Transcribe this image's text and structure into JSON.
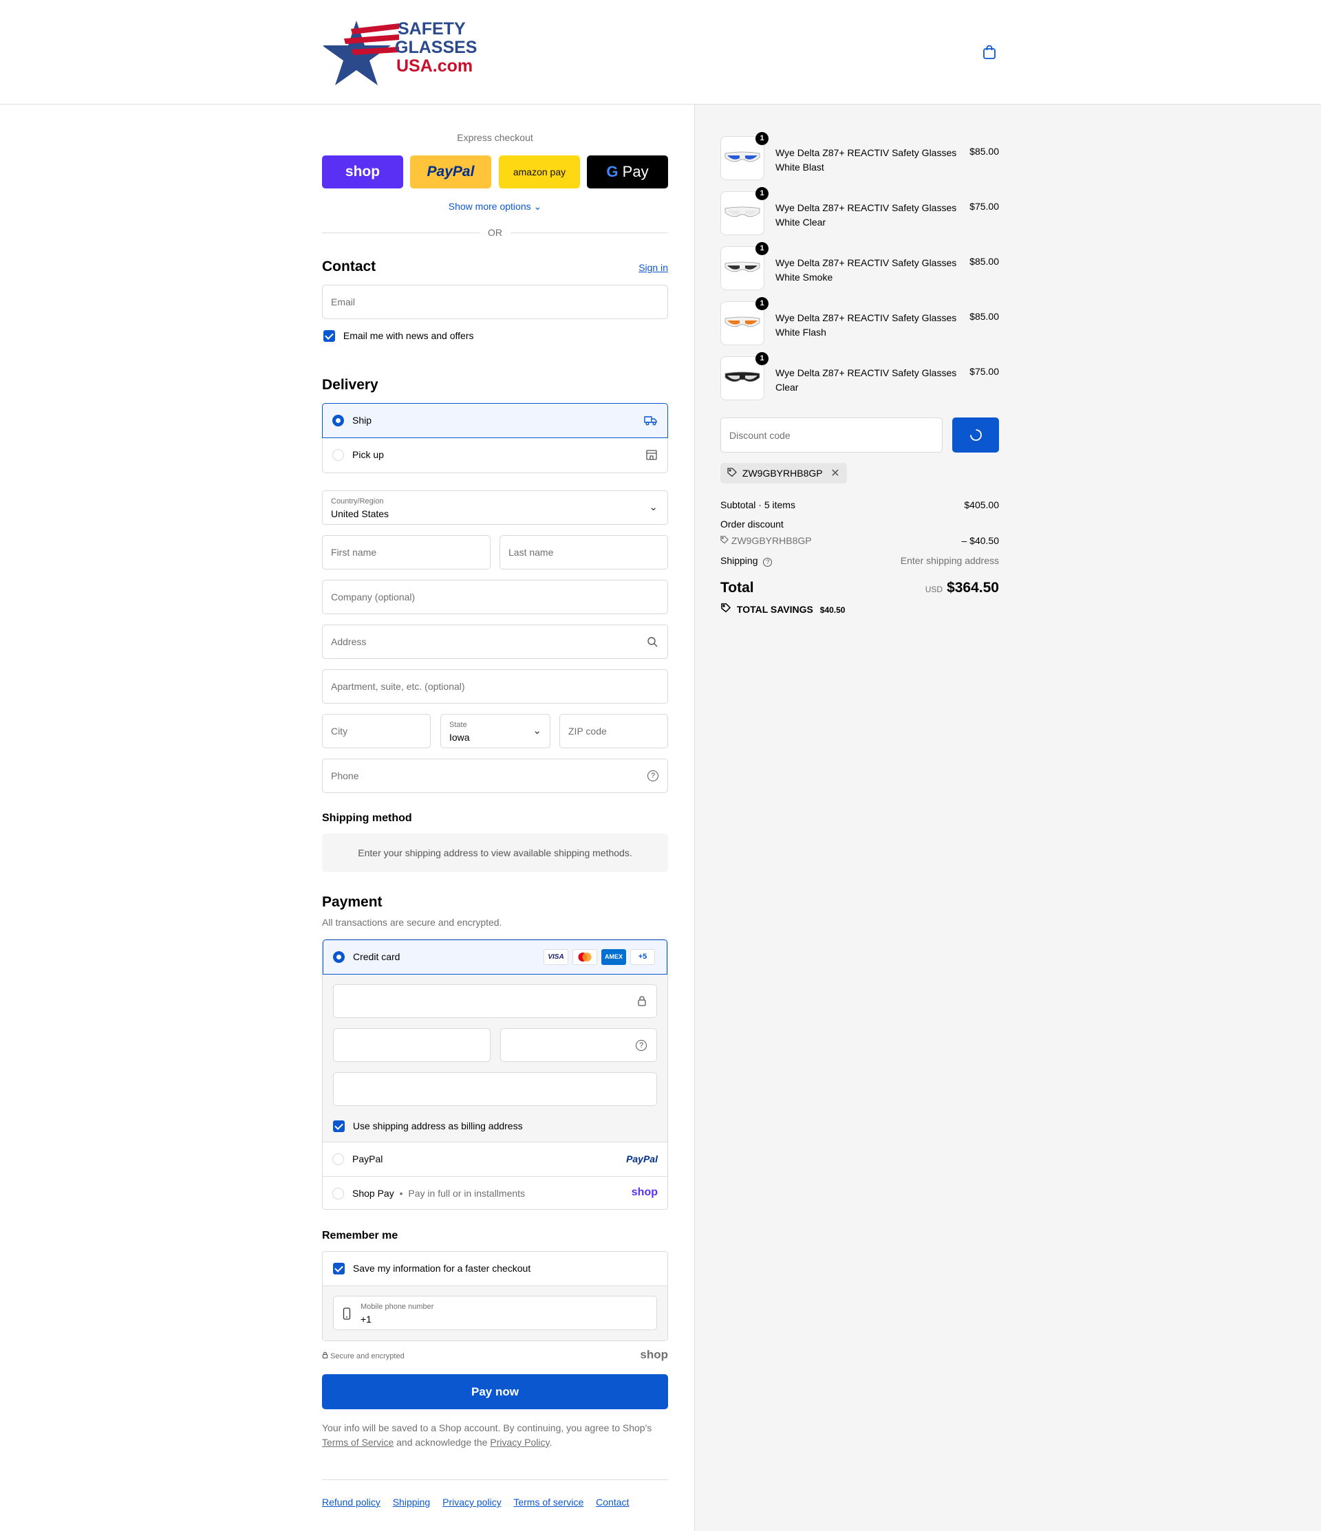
{
  "header": {
    "logo_lines": [
      "SAFETY",
      "GLASSES",
      "USA.com"
    ]
  },
  "express": {
    "title": "Express checkout",
    "buttons": [
      "shop",
      "PayPal",
      "amazon pay",
      "Pay"
    ],
    "show_more": "Show more options",
    "or": "OR"
  },
  "contact": {
    "title": "Contact",
    "signin": "Sign in",
    "email_placeholder": "Email",
    "news_label": "Email me with news and offers"
  },
  "delivery": {
    "title": "Delivery",
    "options": [
      "Ship",
      "Pick up"
    ],
    "country_label": "Country/Region",
    "country_value": "United States",
    "first_name": "First name",
    "last_name": "Last name",
    "company": "Company (optional)",
    "address": "Address",
    "apartment": "Apartment, suite, etc. (optional)",
    "city": "City",
    "state_label": "State",
    "state_value": "Iowa",
    "zip": "ZIP code",
    "phone": "Phone"
  },
  "shipping_method": {
    "title": "Shipping method",
    "notice": "Enter your shipping address to view available shipping methods."
  },
  "payment": {
    "title": "Payment",
    "subtitle": "All transactions are secure and encrypted.",
    "credit_card": "Credit card",
    "card_logos": [
      "VISA",
      "AMEX",
      "+5"
    ],
    "billing_same": "Use shipping address as billing address",
    "paypal": "PayPal",
    "paypal_logo": "PayPal",
    "shoppay": "Shop Pay",
    "shoppay_sub": "Pay in full or in installments",
    "shop_logo": "shop"
  },
  "remember": {
    "title": "Remember me",
    "save_label": "Save my information for a faster checkout",
    "mobile_label": "Mobile phone number",
    "mobile_value": "+1",
    "secure": "Secure and encrypted",
    "shop_logo": "shop"
  },
  "pay_now": "Pay now",
  "legal": {
    "line1": "Your info will be saved to a Shop account. By continuing, you agree to Shop's",
    "terms": "Terms of Service",
    "mid": "and acknowledge the",
    "privacy": "Privacy Policy",
    "end": "."
  },
  "footer_links": [
    "Refund policy",
    "Shipping",
    "Privacy policy",
    "Terms of service",
    "Contact"
  ],
  "cart": {
    "items": [
      {
        "qty": "1",
        "name": "Wye Delta Z87+ REACTIV Safety Glasses",
        "variant": "White Blast",
        "price": "$85.00",
        "lens_color": "#2a5bd7",
        "frame_color": "#f2f2f2"
      },
      {
        "qty": "1",
        "name": "Wye Delta Z87+ REACTIV Safety Glasses",
        "variant": "White Clear",
        "price": "$75.00",
        "lens_color": "#e8e8e8",
        "frame_color": "#f2f2f2"
      },
      {
        "qty": "1",
        "name": "Wye Delta Z87+ REACTIV Safety Glasses",
        "variant": "White Smoke",
        "price": "$85.00",
        "lens_color": "#333333",
        "frame_color": "#f2f2f2"
      },
      {
        "qty": "1",
        "name": "Wye Delta Z87+ REACTIV Safety Glasses",
        "variant": "White Flash",
        "price": "$85.00",
        "lens_color": "#f07a1a",
        "frame_color": "#f2f2f2"
      },
      {
        "qty": "1",
        "name": "Wye Delta Z87+ REACTIV Safety Glasses",
        "variant": "Clear",
        "price": "$75.00",
        "lens_color": "#dddddd",
        "frame_color": "#222222"
      }
    ],
    "discount_placeholder": "Discount code",
    "applied_code": "ZW9GBYRHB8GP",
    "subtotal_label": "Subtotal · 5 items",
    "subtotal_value": "$405.00",
    "order_discount_label": "Order discount",
    "discount_code": "ZW9GBYRHB8GP",
    "discount_value": "– $40.50",
    "shipping_label": "Shipping",
    "shipping_value": "Enter shipping address",
    "total_label": "Total",
    "currency": "USD",
    "total_value": "$364.50",
    "savings_label": "TOTAL SAVINGS",
    "savings_value": "$40.50"
  },
  "colors": {
    "accent": "#0b57d0",
    "shop": "#5a31f4",
    "paypal_yellow": "#ffc439",
    "amazon_yellow": "#ffd814"
  }
}
